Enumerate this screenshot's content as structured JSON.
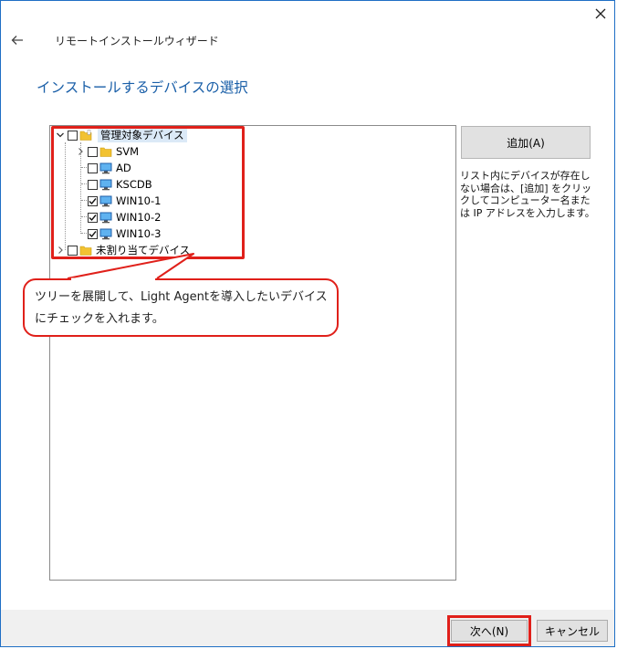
{
  "window": {
    "title": "リモートインストールウィザード",
    "heading": "インストールするデバイスの選択"
  },
  "tree": {
    "root": {
      "label": "管理対象デバイス",
      "expanded": true,
      "checked": false
    },
    "children": [
      {
        "label": "SVM",
        "type": "folder",
        "checked": false,
        "expandable": true
      },
      {
        "label": "AD",
        "type": "computer",
        "checked": false
      },
      {
        "label": "KSCDB",
        "type": "computer",
        "checked": false
      },
      {
        "label": "WIN10-1",
        "type": "computer",
        "checked": true
      },
      {
        "label": "WIN10-2",
        "type": "computer",
        "checked": true
      },
      {
        "label": "WIN10-3",
        "type": "computer",
        "checked": true
      }
    ],
    "unassigned": {
      "label": "未割り当てデバイス",
      "expanded": false,
      "checked": false
    }
  },
  "side": {
    "add_button": "追加(A)",
    "help_text": "リスト内にデバイスが存在しない場合は、[追加] をクリックしてコンピューター名または IP アドレスを入力します。"
  },
  "callout": {
    "text": "ツリーを展開して、Light Agentを導入したいデバイスにチェックを入れます。"
  },
  "footer": {
    "next_button": "次へ(N)",
    "cancel_button": "キャンセル"
  },
  "colors": {
    "accent_heading": "#1a5fa8",
    "annotation_red": "#e0201a",
    "folder_yellow": "#f2c231",
    "monitor_blue": "#2a7fd4"
  }
}
